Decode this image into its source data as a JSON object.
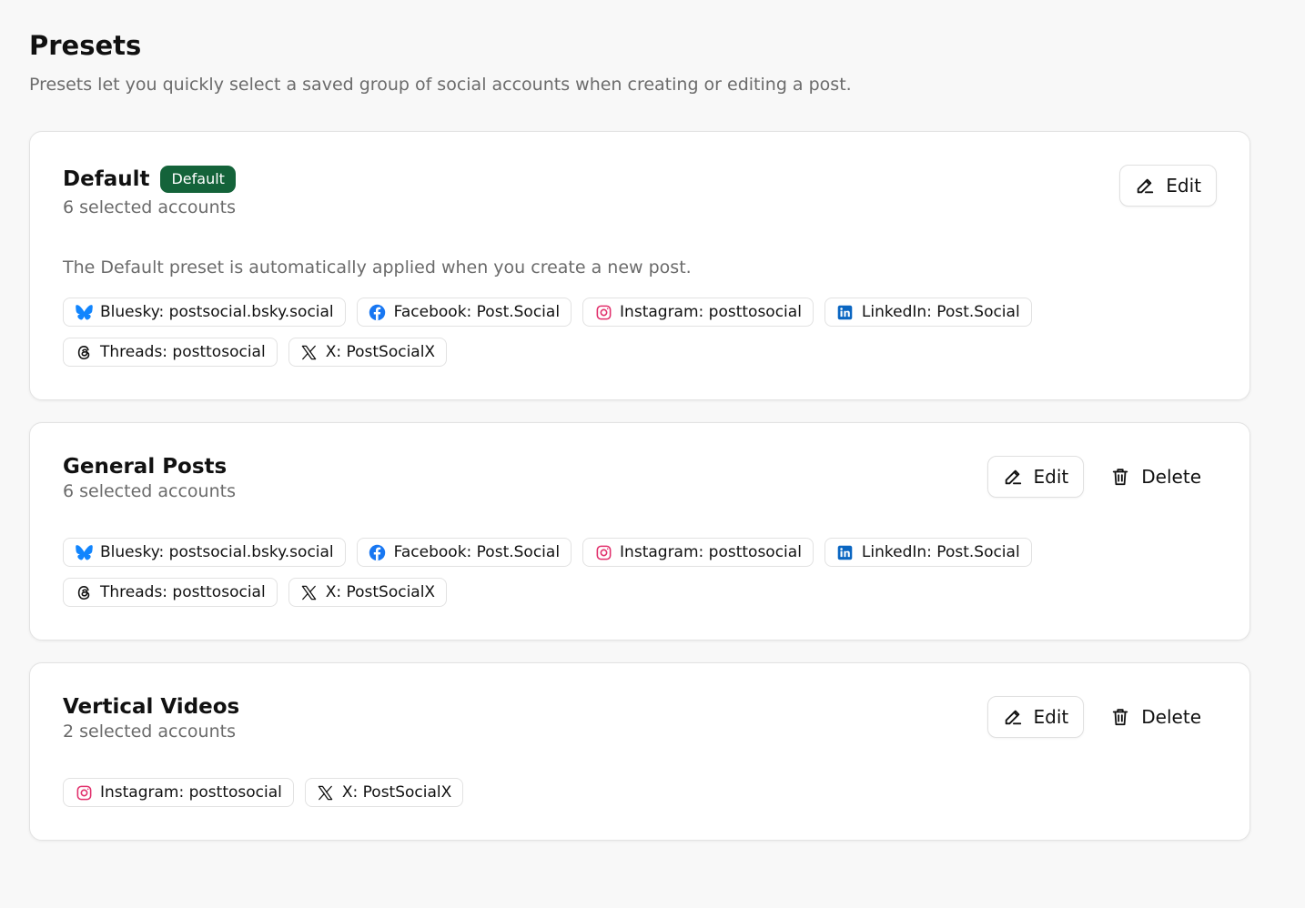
{
  "page": {
    "title": "Presets",
    "subtitle": "Presets let you quickly select a saved group of social accounts when creating or editing a post."
  },
  "colors": {
    "default_badge_bg": "#14633a",
    "bluesky": "#1185fe",
    "facebook": "#1877f2",
    "instagram": "#e1306c",
    "linkedin": "#0a66c2",
    "threads": "#111111",
    "x": "#111111"
  },
  "presets": [
    {
      "name": "Default",
      "badge": "Default",
      "count": "6 selected accounts",
      "description": "The Default preset is automatically applied when you create a new post.",
      "edit_label": "Edit",
      "accounts": [
        {
          "icon": "bluesky-icon",
          "label": "Bluesky: postsocial.bsky.social"
        },
        {
          "icon": "facebook-icon",
          "label": "Facebook: Post.Social"
        },
        {
          "icon": "instagram-icon",
          "label": "Instagram: posttosocial"
        },
        {
          "icon": "linkedin-icon",
          "label": "LinkedIn: Post.Social"
        },
        {
          "icon": "threads-icon",
          "label": "Threads: posttosocial"
        },
        {
          "icon": "x-icon",
          "label": "X: PostSocialX"
        }
      ]
    },
    {
      "name": "General Posts",
      "count": "6 selected accounts",
      "edit_label": "Edit",
      "delete_label": "Delete",
      "accounts": [
        {
          "icon": "bluesky-icon",
          "label": "Bluesky: postsocial.bsky.social"
        },
        {
          "icon": "facebook-icon",
          "label": "Facebook: Post.Social"
        },
        {
          "icon": "instagram-icon",
          "label": "Instagram: posttosocial"
        },
        {
          "icon": "linkedin-icon",
          "label": "LinkedIn: Post.Social"
        },
        {
          "icon": "threads-icon",
          "label": "Threads: posttosocial"
        },
        {
          "icon": "x-icon",
          "label": "X: PostSocialX"
        }
      ]
    },
    {
      "name": "Vertical Videos",
      "count": "2 selected accounts",
      "edit_label": "Edit",
      "delete_label": "Delete",
      "accounts": [
        {
          "icon": "instagram-icon",
          "label": "Instagram: posttosocial"
        },
        {
          "icon": "x-icon",
          "label": "X: PostSocialX"
        }
      ]
    }
  ]
}
